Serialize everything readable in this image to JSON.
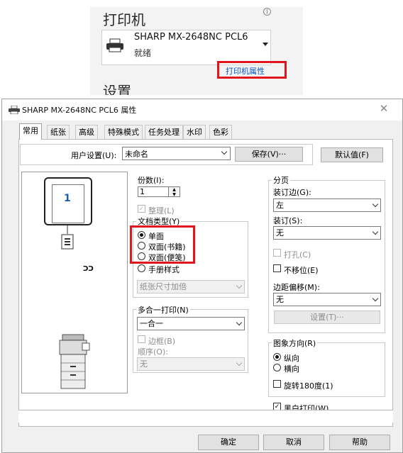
{
  "printer_panel": {
    "title": "打印机",
    "info_icon": "i",
    "printer_name": "SHARP MX-2648NC PCL6",
    "printer_status": "就绪",
    "printer_properties_link": "打印机属性",
    "settings_title": "设置"
  },
  "dialog": {
    "title": "SHARP MX-2648NC PCL6 属性",
    "close_label": "✕",
    "tabs": [
      "常用",
      "纸张",
      "高级",
      "特殊模式",
      "任务处理",
      "水印",
      "色彩"
    ],
    "active_tab": "常用",
    "user_settings": {
      "label": "用户设置(U):",
      "value": "未命名",
      "save_button": "保存(V)···",
      "default_button": "默认值(F)"
    },
    "preview": {
      "page_number": "1",
      "duplex_glyph": "ᑐᑐ"
    },
    "copies": {
      "label": "份数(I):",
      "value": "1"
    },
    "collate": {
      "label": "整理(L)",
      "checked": true,
      "disabled": true
    },
    "document_type": {
      "label": "文档类型(Y)",
      "options": [
        "单面",
        "双面(书籍)",
        "双面(便笺)",
        "手册样式"
      ],
      "selected": "单面",
      "booklet_select": "纸张尺寸加倍"
    },
    "nup": {
      "label": "多合一打印(N)",
      "value": "一合一",
      "border_label": "边框(B)",
      "order_label": "顺序(O):",
      "order_value": "无"
    },
    "staple_section": {
      "label": "分页",
      "binding_label": "装订边(G):",
      "binding_value": "左",
      "staple_label": "装订(S):",
      "staple_value": "无",
      "punch_label": "打孔(C)",
      "no_offset_label": "不移位(E)",
      "margin_shift_label": "边距偏移(M):",
      "margin_shift_value": "无",
      "settings_button": "设置(T)···"
    },
    "orientation": {
      "label": "图象方向(R)",
      "options": [
        "纵向",
        "横向"
      ],
      "selected": "纵向",
      "rotate_label": "旋转180度(1)"
    },
    "bw_print": {
      "label": "黑白打印(W)",
      "checked": true
    },
    "buttons": {
      "ok": "确定",
      "cancel": "取消",
      "help": "帮助"
    }
  },
  "colors": {
    "highlight_red": "#e2141c",
    "link_blue": "#0b57c4",
    "page_number_blue": "#1a5ea8"
  }
}
